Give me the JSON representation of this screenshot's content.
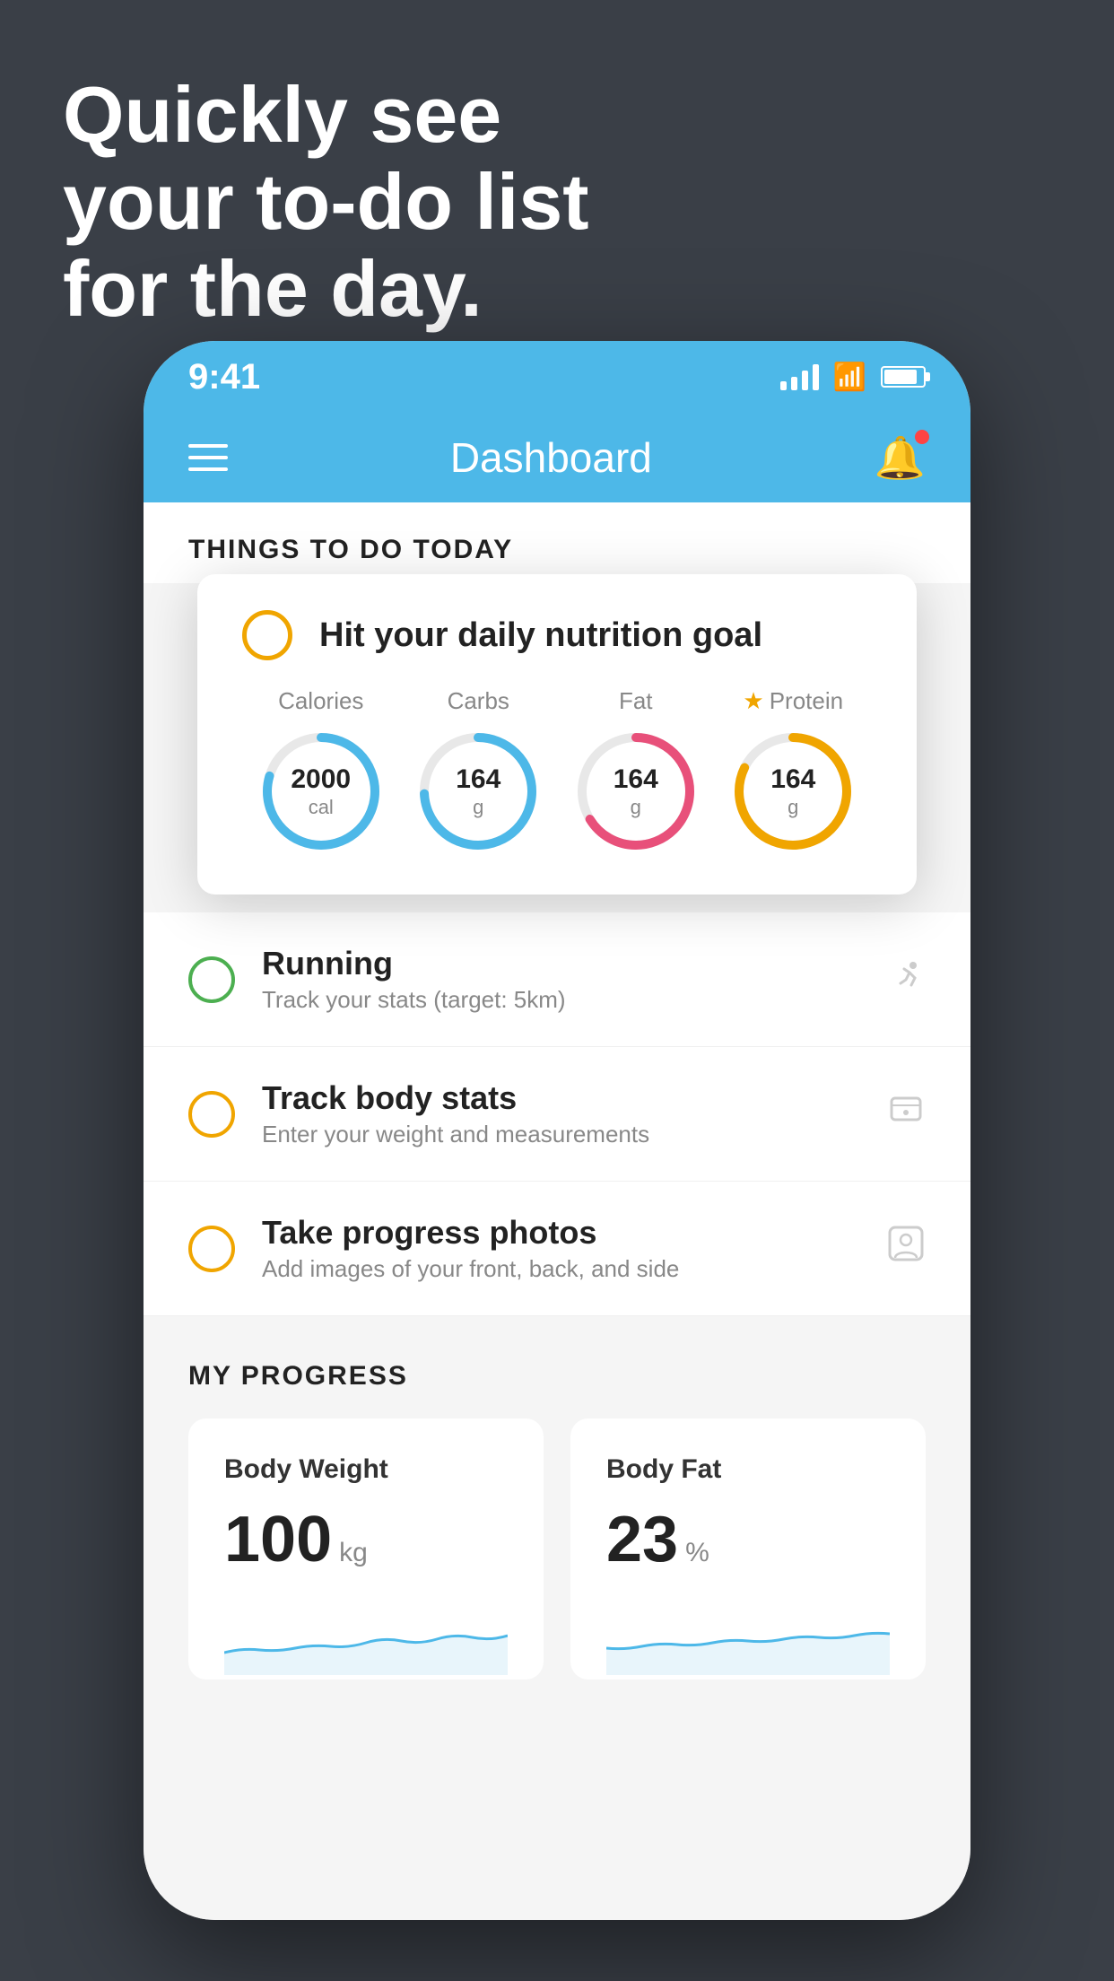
{
  "headline": {
    "line1": "Quickly see",
    "line2": "your to-do list",
    "line3": "for the day."
  },
  "status_bar": {
    "time": "9:41",
    "bg_color": "#4db8e8"
  },
  "nav": {
    "title": "Dashboard",
    "bg_color": "#4db8e8"
  },
  "things_to_do": {
    "section_title": "THINGS TO DO TODAY",
    "nutrition_card": {
      "title": "Hit your daily nutrition goal",
      "stats": [
        {
          "label": "Calories",
          "value": "2000",
          "unit": "cal",
          "color": "#4db8e8",
          "starred": false
        },
        {
          "label": "Carbs",
          "value": "164",
          "unit": "g",
          "color": "#4db8e8",
          "starred": false
        },
        {
          "label": "Fat",
          "value": "164",
          "unit": "g",
          "color": "#e8507a",
          "starred": false
        },
        {
          "label": "Protein",
          "value": "164",
          "unit": "g",
          "color": "#f0a500",
          "starred": true
        }
      ]
    },
    "todo_items": [
      {
        "name": "Running",
        "desc": "Track your stats (target: 5km)",
        "circle_color": "green",
        "icon": "👟"
      },
      {
        "name": "Track body stats",
        "desc": "Enter your weight and measurements",
        "circle_color": "yellow",
        "icon": "⚖️"
      },
      {
        "name": "Take progress photos",
        "desc": "Add images of your front, back, and side",
        "circle_color": "yellow",
        "icon": "👤"
      }
    ]
  },
  "my_progress": {
    "section_title": "MY PROGRESS",
    "cards": [
      {
        "title": "Body Weight",
        "value": "100",
        "unit": "kg"
      },
      {
        "title": "Body Fat",
        "value": "23",
        "unit": "%"
      }
    ]
  }
}
